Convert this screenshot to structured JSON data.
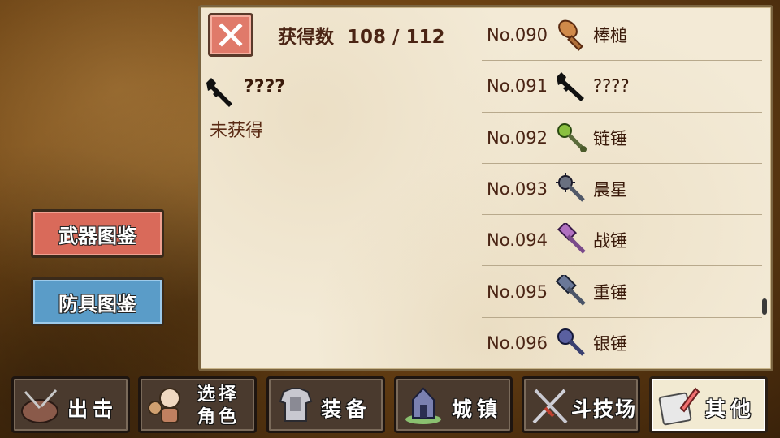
{
  "header": {
    "count_label": "获得数",
    "count_value": "108 / 112"
  },
  "detail": {
    "name": "????",
    "status": "未获得",
    "icon": "unknown-sword-silhouette-icon"
  },
  "side_buttons": {
    "weapon": "武器图鉴",
    "armor": "防具图鉴"
  },
  "list": [
    {
      "no": "No.090",
      "name": "棒槌",
      "icon": "club-icon"
    },
    {
      "no": "No.091",
      "name": "????",
      "icon": "unknown-weapon-icon"
    },
    {
      "no": "No.092",
      "name": "链锤",
      "icon": "flail-icon"
    },
    {
      "no": "No.093",
      "name": "晨星",
      "icon": "morning-star-icon"
    },
    {
      "no": "No.094",
      "name": "战锤",
      "icon": "war-hammer-icon"
    },
    {
      "no": "No.095",
      "name": "重锤",
      "icon": "heavy-hammer-icon"
    },
    {
      "no": "No.096",
      "name": "银锤",
      "icon": "silver-hammer-icon"
    }
  ],
  "nav": {
    "sortie": "出击",
    "select_1": "选择",
    "select_2": "角色",
    "equip": "装备",
    "town": "城镇",
    "arena": "斗技场",
    "other": "其他"
  },
  "colors": {
    "weapon_button": "#d96a5a",
    "armor_button": "#5a9cc8",
    "close_button": "#e07a6a",
    "parchment": "#f3ead6"
  }
}
